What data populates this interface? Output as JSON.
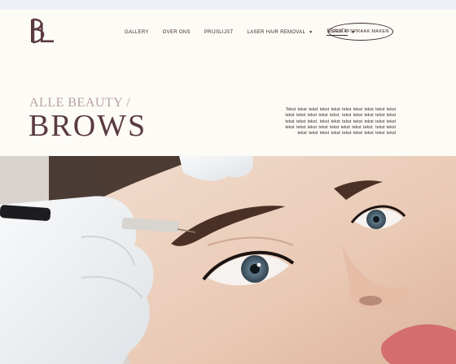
{
  "nav": {
    "items": [
      {
        "label": "GALLERY",
        "has_dropdown": false,
        "active": false
      },
      {
        "label": "OVER ONS",
        "has_dropdown": false,
        "active": false
      },
      {
        "label": "PRIJSLIJST",
        "has_dropdown": false,
        "active": false
      },
      {
        "label": "LASER HAIR REMOVAL",
        "has_dropdown": true,
        "active": false
      },
      {
        "label": "BEAUTY",
        "has_dropdown": true,
        "active": true
      }
    ],
    "cta_label": "EEN AFSPRAAK MAKEN"
  },
  "hero": {
    "kicker": "ALLE BEAUTY /",
    "title": "BROWS",
    "description": "Tekst tekst tekst tekst tekst tekst tekst tekst tekst tekst tekst tekst tekst tekst tekst. tekst tekst   tekst tekst   tekst tekst  tekst tekst. tekst tekst tekst tekst tekst tekst tekst tekst tekst tekst tekst tekst tekst tekst tekst. tekst tekst   tekst tekst   tekst tekst  tekst tekst tekst tekst tekst"
  },
  "logo": {
    "letters": "BL"
  },
  "colors": {
    "brand": "#5a3a40",
    "kicker": "#b8a0a4",
    "background": "#fcfbf6"
  }
}
